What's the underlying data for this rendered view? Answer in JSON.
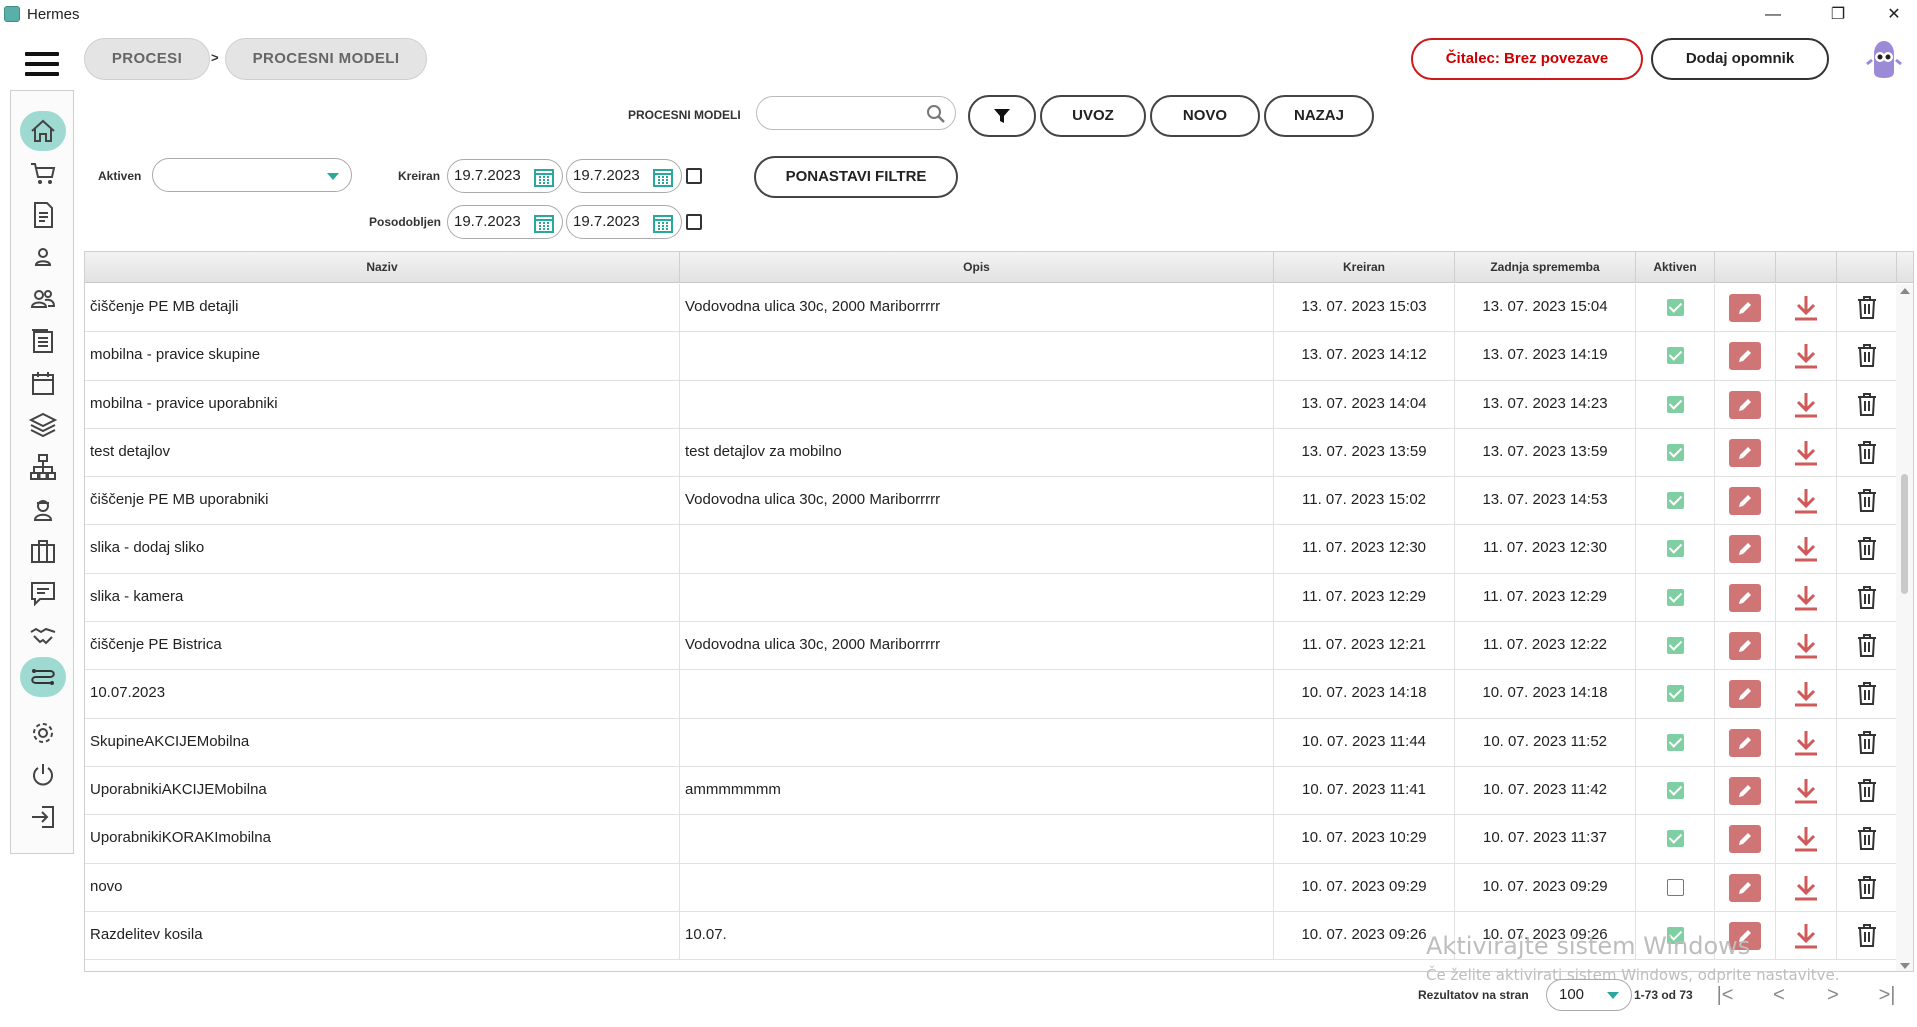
{
  "window": {
    "title": "Hermes",
    "controls": {
      "minimize": "—",
      "maximize": "❐",
      "close": "✕"
    }
  },
  "breadcrumb": [
    "PROCESI",
    "PROCESNI MODELI"
  ],
  "breadcrumb_sep": ">",
  "header": {
    "reader_label": "Čitalec: Brez povezave",
    "reminder_label": "Dodaj opomnik"
  },
  "toolbar": {
    "search_label": "PROCESNI MODELI",
    "search_value": "",
    "import_label": "UVOZ",
    "new_label": "NOVO",
    "back_label": "NAZAJ"
  },
  "filters": {
    "active_label": "Aktiven",
    "active_value": "",
    "created_label": "Kreiran",
    "created_from": "19.7.2023",
    "created_to": "19.7.2023",
    "updated_label": "Posodobljen",
    "updated_from": "19.7.2023",
    "updated_to": "19.7.2023",
    "reset_label": "PONASTAVI FILTRE"
  },
  "sidebar": {
    "items": [
      "home",
      "cart",
      "document",
      "user",
      "users",
      "list",
      "calendar",
      "layers",
      "hierarchy",
      "worker",
      "briefcase",
      "chat",
      "handshake",
      "processes",
      "settings",
      "power",
      "logout"
    ],
    "active": "processes"
  },
  "table": {
    "columns": [
      "Naziv",
      "Opis",
      "Kreiran",
      "Zadnja sprememba",
      "Aktiven",
      "",
      "",
      ""
    ],
    "rows": [
      {
        "name": "čiščenje PE MB detajli",
        "desc": "Vodovodna ulica 30c, 2000 Mariborrrrr",
        "created": "13. 07. 2023 15:03",
        "modified": "13. 07. 2023 15:04",
        "active": true
      },
      {
        "name": "mobilna - pravice skupine",
        "desc": "",
        "created": "13. 07. 2023 14:12",
        "modified": "13. 07. 2023 14:19",
        "active": true
      },
      {
        "name": "mobilna - pravice uporabniki",
        "desc": "",
        "created": "13. 07. 2023 14:04",
        "modified": "13. 07. 2023 14:23",
        "active": true
      },
      {
        "name": "test detajlov",
        "desc": "test detajlov za mobilno",
        "created": "13. 07. 2023 13:59",
        "modified": "13. 07. 2023 13:59",
        "active": true
      },
      {
        "name": "čiščenje PE MB uporabniki",
        "desc": "Vodovodna ulica 30c, 2000 Mariborrrrr",
        "created": "11. 07. 2023 15:02",
        "modified": "13. 07. 2023 14:53",
        "active": true
      },
      {
        "name": "slika - dodaj sliko",
        "desc": "",
        "created": "11. 07. 2023 12:30",
        "modified": "11. 07. 2023 12:30",
        "active": true
      },
      {
        "name": "slika - kamera",
        "desc": "",
        "created": "11. 07. 2023 12:29",
        "modified": "11. 07. 2023 12:29",
        "active": true
      },
      {
        "name": "čiščenje PE Bistrica",
        "desc": "Vodovodna ulica 30c, 2000 Mariborrrrr",
        "created": "11. 07. 2023 12:21",
        "modified": "11. 07. 2023 12:22",
        "active": true
      },
      {
        "name": "10.07.2023",
        "desc": "",
        "created": "10. 07. 2023 14:18",
        "modified": "10. 07. 2023 14:18",
        "active": true
      },
      {
        "name": "SkupineAKCIJEMobilna",
        "desc": "",
        "created": "10. 07. 2023 11:44",
        "modified": "10. 07. 2023 11:52",
        "active": true
      },
      {
        "name": "UporabnikiAKCIJEMobilna",
        "desc": "ammmmmmm",
        "created": "10. 07. 2023 11:41",
        "modified": "10. 07. 2023 11:42",
        "active": true
      },
      {
        "name": "UporabnikiKORAKImobilna",
        "desc": "",
        "created": "10. 07. 2023 10:29",
        "modified": "10. 07. 2023 11:37",
        "active": true
      },
      {
        "name": "novo",
        "desc": "",
        "created": "10. 07. 2023 09:29",
        "modified": "10. 07. 2023 09:29",
        "active": false
      },
      {
        "name": "Razdelitev kosila",
        "desc": "10.07.",
        "created": "10. 07. 2023 09:26",
        "modified": "10. 07. 2023 09:26",
        "active": true
      }
    ]
  },
  "pagination": {
    "label": "Rezultatov na stran",
    "page_size": "100",
    "range": "1-73 od 73",
    "first": "|<",
    "prev": "<",
    "next": ">",
    "last": ">|"
  },
  "watermark": {
    "line1": "Aktivirajte sistem Windows",
    "line2": "Če želite aktivirati sistem Windows, odprite nastavitve."
  },
  "colors": {
    "accent": "#2aa89c",
    "active_nav": "#9fdad2",
    "danger": "#cc0000",
    "edit_button": "#d07575",
    "download_icon": "#d05a5a"
  }
}
